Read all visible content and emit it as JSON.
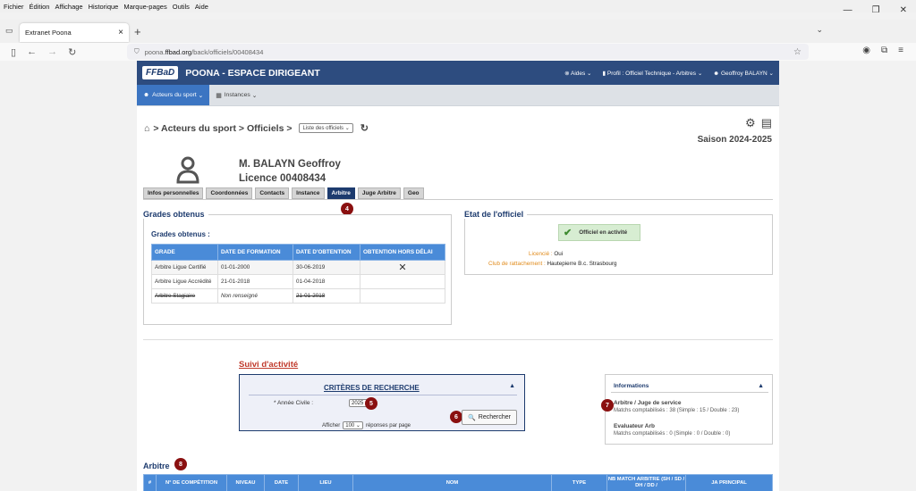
{
  "browser": {
    "menu": [
      "Fichier",
      "Édition",
      "Affichage",
      "Historique",
      "Marque-pages",
      "Outils",
      "Aide"
    ],
    "tab_title": "Extranet Poona",
    "url_prefix": "poona.",
    "url_domain": "ffbad.org",
    "url_path": "/back/officiels/00408434"
  },
  "app": {
    "logo": "FFBaD",
    "title": "POONA - ESPACE DIRIGEANT",
    "aides": "Aides",
    "profil": "Profil : Officiel Technique - Arbitres",
    "user": "Geoffroy BALAYN",
    "subnav": [
      "Acteurs du sport",
      "Instances"
    ]
  },
  "breadcrumb": {
    "text": "> Acteurs du sport > Officiels >",
    "select": "Liste des officiels"
  },
  "season": "Saison 2024-2025",
  "person": {
    "name": "M. BALAYN Geoffroy",
    "licence": "Licence 00408434"
  },
  "tabs": [
    "Infos personnelles",
    "Coordonnées",
    "Contacts",
    "Instance",
    "Arbitre",
    "Juge Arbitre",
    "Geo"
  ],
  "badges": [
    "4",
    "5",
    "6",
    "7",
    "8"
  ],
  "grades": {
    "section_title": "Grades obtenus",
    "sub_title": "Grades obtenus :",
    "headers": [
      "GRADE",
      "DATE DE FORMATION",
      "DATE D'OBTENTION",
      "OBTENTION HORS DÉLAI"
    ],
    "rows": [
      {
        "grade": "Arbitre Ligue Certifié",
        "formation": "01-01-2000",
        "obtention": "30-06-2019",
        "hors_delai": "✕"
      },
      {
        "grade": "Arbitre Ligue Accrédité",
        "formation": "21-01-2018",
        "obtention": "01-04-2018",
        "hors_delai": ""
      },
      {
        "grade": "Arbitre Stagiaire",
        "formation": "Non renseigné",
        "obtention": "21-01-2018",
        "hors_delai": ""
      }
    ]
  },
  "etat": {
    "title": "Etat de l'officiel",
    "status": "Officiel en activité",
    "licencie_label": "Licencié :",
    "licencie_value": "Oui",
    "club_label": "Club de rattachement :",
    "club_value": "Hautepierre B.c. Strasbourg"
  },
  "suivi": {
    "title": "Suivi d'activité",
    "criteria_title": "CRITÈRES DE RECHERCHE",
    "annee_label": "* Année Civile :",
    "annee_value": "2025",
    "search_button": "Rechercher",
    "afficher_label": "Afficher",
    "per_page": "100",
    "per_page_suffix": "réponses par page"
  },
  "informations": {
    "title": "Informations",
    "items": [
      {
        "role": "Arbitre / Juge de service",
        "matches": "Matchs comptabilisés : 38 (Simple : 15 / Double : 23)"
      },
      {
        "role": "Evaluateur Arb",
        "matches": "Matchs comptabilisés : 0 (Simple : 0 / Double : 0)"
      }
    ]
  },
  "arbitre": {
    "title": "Arbitre",
    "headers": [
      "#",
      "N° DE COMPÉTITION",
      "NIVEAU",
      "DATE",
      "LIEU",
      "NOM",
      "TYPE",
      "NB MATCH ARBITRE (SH / SD / DH / DD /",
      "JA PRINCIPAL"
    ]
  }
}
